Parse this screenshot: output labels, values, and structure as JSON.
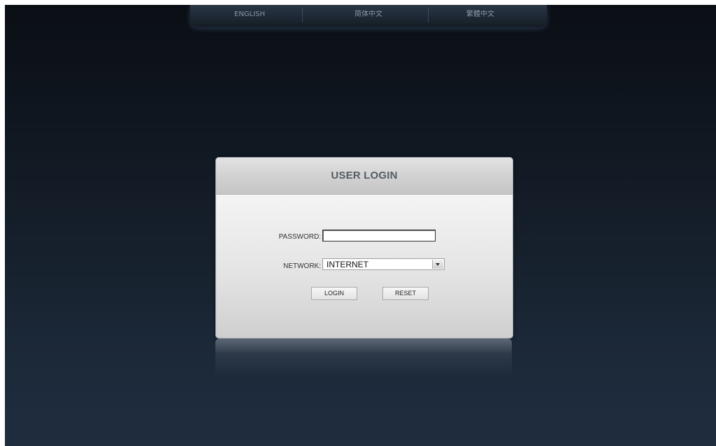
{
  "language_bar": {
    "items": [
      {
        "id": "en",
        "label": "ENGLISH"
      },
      {
        "id": "sc",
        "label": "简体中文"
      },
      {
        "id": "tc",
        "label": "繁體中文"
      }
    ]
  },
  "login_panel": {
    "title": "USER LOGIN",
    "password_label": "PASSWORD:",
    "password_value": "",
    "network_label": "NETWORK:",
    "network_selected": "INTERNET",
    "login_button": "LOGIN",
    "reset_button": "RESET"
  },
  "colors": {
    "background_top": "#0b0f15",
    "background_bottom": "#1f2d3f",
    "panel": "#e4e4e4",
    "title_text": "#555b64"
  },
  "icons": {
    "dropdown": "chevron-down-icon"
  }
}
